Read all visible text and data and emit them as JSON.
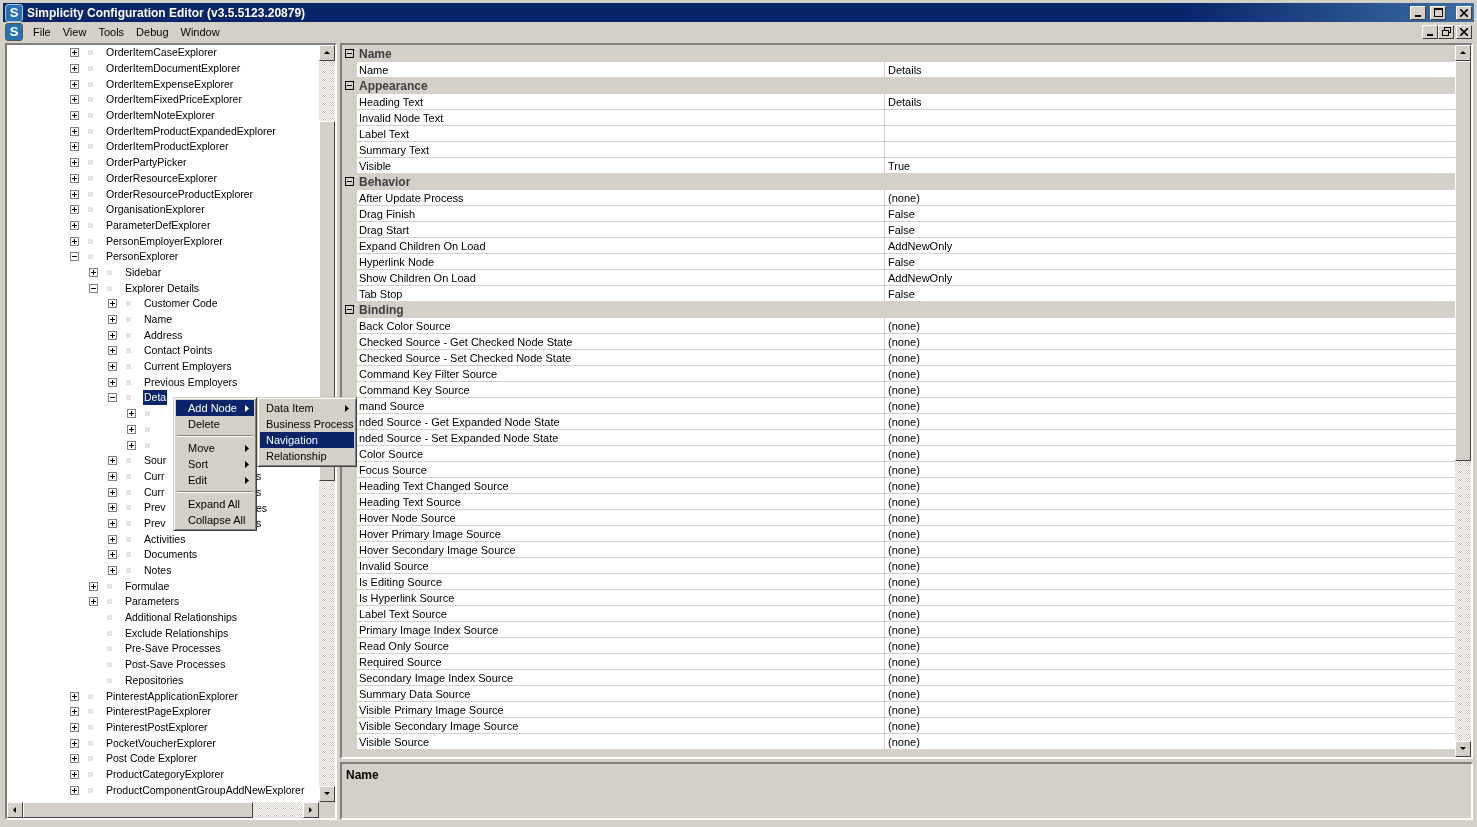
{
  "window": {
    "icon_text": "S",
    "title": "Simplicity Configuration Editor (v3.5.5123.20879)"
  },
  "menu_bar": {
    "icon_text": "S",
    "items": [
      "File",
      "View",
      "Tools",
      "Debug",
      "Window"
    ]
  },
  "tree": {
    "items": [
      {
        "label": "OrderItemCaseExplorer",
        "expandable": true,
        "expanded": false,
        "selected": false
      },
      {
        "label": "OrderItemDocumentExplorer",
        "expandable": true,
        "expanded": false,
        "selected": false
      },
      {
        "label": "OrderItemExpenseExplorer",
        "expandable": true,
        "expanded": false,
        "selected": false
      },
      {
        "label": "OrderItemFixedPriceExplorer",
        "expandable": true,
        "expanded": false,
        "selected": false
      },
      {
        "label": "OrderItemNoteExplorer",
        "expandable": true,
        "expanded": false,
        "selected": false
      },
      {
        "label": "OrderItemProductExpandedExplorer",
        "expandable": true,
        "expanded": false,
        "selected": false
      },
      {
        "label": "OrderItemProductExplorer",
        "expandable": true,
        "expanded": false,
        "selected": false
      },
      {
        "label": "OrderPartyPicker",
        "expandable": true,
        "expanded": false,
        "selected": false
      },
      {
        "label": "OrderResourceExplorer",
        "expandable": true,
        "expanded": false,
        "selected": false
      },
      {
        "label": "OrderResourceProductExplorer",
        "expandable": true,
        "expanded": false,
        "selected": false
      },
      {
        "label": "OrganisationExplorer",
        "expandable": true,
        "expanded": false,
        "selected": false
      },
      {
        "label": "ParameterDefExplorer",
        "expandable": true,
        "expanded": false,
        "selected": false
      },
      {
        "label": "PersonEmployerExplorer",
        "expandable": true,
        "expanded": false,
        "selected": false
      },
      {
        "label": "PersonExplorer",
        "expandable": true,
        "expanded": true,
        "selected": false,
        "children": [
          {
            "label": "Sidebar",
            "expandable": true,
            "expanded": false,
            "selected": false
          },
          {
            "label": "Explorer Details",
            "expandable": true,
            "expanded": true,
            "selected": false,
            "children": [
              {
                "label": "Customer Code",
                "expandable": true,
                "expanded": false,
                "selected": false
              },
              {
                "label": "Name",
                "expandable": true,
                "expanded": false,
                "selected": false
              },
              {
                "label": "Address",
                "expandable": true,
                "expanded": false,
                "selected": false
              },
              {
                "label": "Contact Points",
                "expandable": true,
                "expanded": false,
                "selected": false
              },
              {
                "label": "Current Employers",
                "expandable": true,
                "expanded": false,
                "selected": false
              },
              {
                "label": "Previous Employers",
                "expandable": true,
                "expanded": false,
                "selected": false
              },
              {
                "label": "Deta",
                "expandable": true,
                "expanded": true,
                "selected": true,
                "children": [
                  {
                    "expandable": true,
                    "expanded": false
                  },
                  {
                    "expandable": true,
                    "expanded": false
                  },
                  {
                    "expandable": true,
                    "expanded": false
                  }
                ]
              },
              {
                "label": "Sour",
                "expandable": true,
                "expanded": false,
                "selected": false
              },
              {
                "label": "Curr",
                "tail": "s",
                "expandable": true,
                "expanded": false,
                "selected": false
              },
              {
                "label": "Curr",
                "tail": "s",
                "expandable": true,
                "expanded": false,
                "selected": false
              },
              {
                "label": "Prev",
                "tail": "es",
                "expandable": true,
                "expanded": false,
                "selected": false
              },
              {
                "label": "Prev",
                "tail": "s",
                "expandable": true,
                "expanded": false,
                "selected": false
              },
              {
                "label": "Activities",
                "expandable": true,
                "expanded": false,
                "selected": false
              },
              {
                "label": "Documents",
                "expandable": true,
                "expanded": false,
                "selected": false
              },
              {
                "label": "Notes",
                "expandable": true,
                "expanded": false,
                "selected": false
              }
            ]
          },
          {
            "label": "Formulae",
            "expandable": true,
            "expanded": false,
            "selected": false
          },
          {
            "label": "Parameters",
            "expandable": true,
            "expanded": false,
            "selected": false
          },
          {
            "label": "Additional Relationships",
            "expandable": false,
            "selected": false
          },
          {
            "label": "Exclude Relationships",
            "expandable": false,
            "selected": false
          },
          {
            "label": "Pre-Save Processes",
            "expandable": false,
            "selected": false
          },
          {
            "label": "Post-Save Processes",
            "expandable": false,
            "selected": false
          },
          {
            "label": "Repositories",
            "expandable": false,
            "selected": false
          }
        ]
      },
      {
        "label": "PinterestApplicationExplorer",
        "expandable": true,
        "expanded": false,
        "selected": false
      },
      {
        "label": "PinterestPageExplorer",
        "expandable": true,
        "expanded": false,
        "selected": false
      },
      {
        "label": "PinterestPostExplorer",
        "expandable": true,
        "expanded": false,
        "selected": false
      },
      {
        "label": "PocketVoucherExplorer",
        "expandable": true,
        "expanded": false,
        "selected": false
      },
      {
        "label": "Post Code Explorer",
        "expandable": true,
        "expanded": false,
        "selected": false
      },
      {
        "label": "ProductCategoryExplorer",
        "expandable": true,
        "expanded": false,
        "selected": false
      },
      {
        "label": "ProductComponentGroupAddNewExplorer",
        "expandable": true,
        "expanded": false,
        "selected": false
      }
    ]
  },
  "context_menu": {
    "items": [
      {
        "kind": "item",
        "label": "Add Node",
        "submenu": true,
        "selected": true
      },
      {
        "kind": "item",
        "label": "Delete",
        "submenu": false,
        "selected": false
      },
      {
        "kind": "separator"
      },
      {
        "kind": "item",
        "label": "Move",
        "submenu": true,
        "selected": false
      },
      {
        "kind": "item",
        "label": "Sort",
        "submenu": true,
        "selected": false
      },
      {
        "kind": "item",
        "label": "Edit",
        "submenu": true,
        "selected": false
      },
      {
        "kind": "separator"
      },
      {
        "kind": "item",
        "label": "Expand All",
        "submenu": false,
        "selected": false
      },
      {
        "kind": "item",
        "label": "Collapse All",
        "submenu": false,
        "selected": false
      }
    ]
  },
  "submenu": {
    "items": [
      {
        "kind": "item",
        "label": "Data Item",
        "submenu": true,
        "selected": false
      },
      {
        "kind": "item",
        "label": "Business Process",
        "submenu": false,
        "selected": false
      },
      {
        "kind": "item",
        "label": "Navigation",
        "submenu": false,
        "selected": true
      },
      {
        "kind": "item",
        "label": "Relationship",
        "submenu": false,
        "selected": false
      }
    ]
  },
  "property_grid": {
    "categories": [
      {
        "name": "Name",
        "expanded": true,
        "properties": [
          {
            "name": "Name",
            "value": "Details"
          }
        ]
      },
      {
        "name": "Appearance",
        "expanded": true,
        "properties": [
          {
            "name": "Heading Text",
            "value": "Details"
          },
          {
            "name": "Invalid Node Text"
          },
          {
            "name": "Label Text"
          },
          {
            "name": "Summary Text"
          },
          {
            "name": "Visible",
            "value": "True"
          }
        ]
      },
      {
        "name": "Behavior",
        "expanded": true,
        "properties": [
          {
            "name": "After Update Process",
            "value": "(none)"
          },
          {
            "name": "Drag Finish",
            "value": "False"
          },
          {
            "name": "Drag Start",
            "value": "False"
          },
          {
            "name": "Expand Children On Load",
            "value": "AddNewOnly"
          },
          {
            "name": "Hyperlink Node",
            "value": "False"
          },
          {
            "name": "Show Children On Load",
            "value": "AddNewOnly"
          },
          {
            "name": "Tab Stop",
            "value": "False"
          }
        ]
      },
      {
        "name": "Binding",
        "expanded": true,
        "properties": [
          {
            "name": "Back Color Source",
            "value": "(none)"
          },
          {
            "name": "Checked Source - Get Checked Node State",
            "value": "(none)"
          },
          {
            "name": "Checked Source - Set Checked Node State",
            "value": "(none)"
          },
          {
            "name": "Command Key Filter Source",
            "value": "(none)"
          },
          {
            "name": "Command Key Source",
            "value": "(none)"
          },
          {
            "name": "mand Source",
            "value": "(none)"
          },
          {
            "name": "nded Source - Get Expanded Node State",
            "value": "(none)"
          },
          {
            "name": "nded Source - Set Expanded Node State",
            "value": "(none)"
          },
          {
            "name": "Color Source",
            "value": "(none)"
          },
          {
            "name": "Focus Source",
            "value": "(none)"
          },
          {
            "name": "Heading Text Changed Source",
            "value": "(none)"
          },
          {
            "name": "Heading Text Source",
            "value": "(none)"
          },
          {
            "name": "Hover Node Source",
            "value": "(none)"
          },
          {
            "name": "Hover Primary Image Source",
            "value": "(none)"
          },
          {
            "name": "Hover Secondary Image Source",
            "value": "(none)"
          },
          {
            "name": "Invalid Source",
            "value": "(none)"
          },
          {
            "name": "Is Editing Source",
            "value": "(none)"
          },
          {
            "name": "Is Hyperlink Source",
            "value": "(none)"
          },
          {
            "name": "Label Text Source",
            "value": "(none)"
          },
          {
            "name": "Primary Image Index Source",
            "value": "(none)"
          },
          {
            "name": "Read Only Source",
            "value": "(none)"
          },
          {
            "name": "Required Source",
            "value": "(none)"
          },
          {
            "name": "Secondary Image Index Source",
            "value": "(none)"
          },
          {
            "name": "Summary Data Source",
            "value": "(none)"
          },
          {
            "name": "Visible Primary Image Source",
            "value": "(none)"
          },
          {
            "name": "Visible Secondary Image Source",
            "value": "(none)"
          },
          {
            "name": "Visible Source",
            "value": "(none)"
          }
        ]
      }
    ]
  },
  "description": {
    "title": "Name"
  }
}
